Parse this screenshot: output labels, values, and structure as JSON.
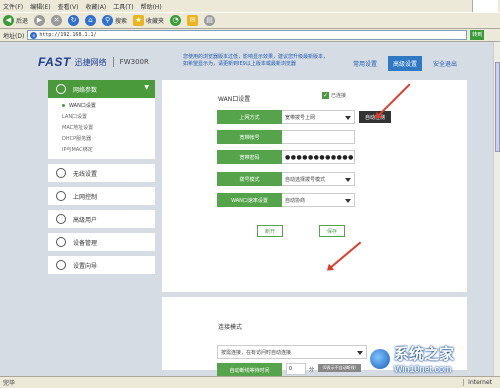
{
  "browser": {
    "menu": [
      "文件(F)",
      "编辑(E)",
      "查看(V)",
      "收藏(A)",
      "工具(T)",
      "帮助(H)"
    ],
    "toolbar": {
      "back": "后退",
      "search": "搜索",
      "favorites": "收藏夹"
    },
    "address_label": "地址(D)",
    "url": "http://192.168.1.1/",
    "go": "转到",
    "status_left": "完毕",
    "status_zone": "Internet"
  },
  "header": {
    "brand": "FAST",
    "brand_cn": "迅捷网络",
    "model": "FW300R",
    "notice": "您使用的浏览器版本过低，影响显示效果，建议您升级最新版本，如希望显示为，请更新到IE9以上版本或最新浏览器",
    "nav": [
      "常用设置",
      "高级设置",
      "安全退出"
    ],
    "active_nav": "高级设置",
    "accent": "#2f78c4"
  },
  "sidebar": {
    "groups": [
      {
        "label": "网络参数",
        "icon": "globe-icon",
        "expanded": true,
        "items": [
          "WAN口设置",
          "LAN口设置",
          "MAC地址设置",
          "DHCP服务器",
          "IP与MAC绑定"
        ],
        "active_item": "WAN口设置"
      },
      {
        "label": "无线设置",
        "icon": "wifi-icon"
      },
      {
        "label": "上网控制",
        "icon": "control-icon"
      },
      {
        "label": "高级用户",
        "icon": "user-icon"
      },
      {
        "label": "设备管理",
        "icon": "device-icon"
      },
      {
        "label": "设置向导",
        "icon": "wizard-icon"
      }
    ],
    "active_color": "#4a9a3c"
  },
  "wan": {
    "title": "WAN口设置",
    "enabled_label": "已连接",
    "fields": [
      {
        "label": "上网方式",
        "value": "宽带拨号上网",
        "type": "select"
      },
      {
        "label": "宽带帐号",
        "value": "",
        "type": "text"
      },
      {
        "label": "宽带密码",
        "value": "●●●●●●●●●●●●",
        "type": "password"
      },
      {
        "label": "拨号模式",
        "value": "自动选择拨号模式",
        "type": "select"
      },
      {
        "label": "WAN口速率设置",
        "value": "自动协商",
        "type": "select"
      }
    ],
    "autodetect": "自动检测",
    "disconnect": "断开",
    "save": "保存"
  },
  "connect": {
    "title": "连接模式",
    "mode": "按需连接，在有访问时自动连接",
    "idle_label": "自动断线等待时间",
    "idle_value": "0",
    "idle_unit": "分",
    "idle_note": "（0表示不自动断线）",
    "save": "保存"
  },
  "watermark": {
    "cn": "系统之家",
    "url": "Win10net.com"
  }
}
